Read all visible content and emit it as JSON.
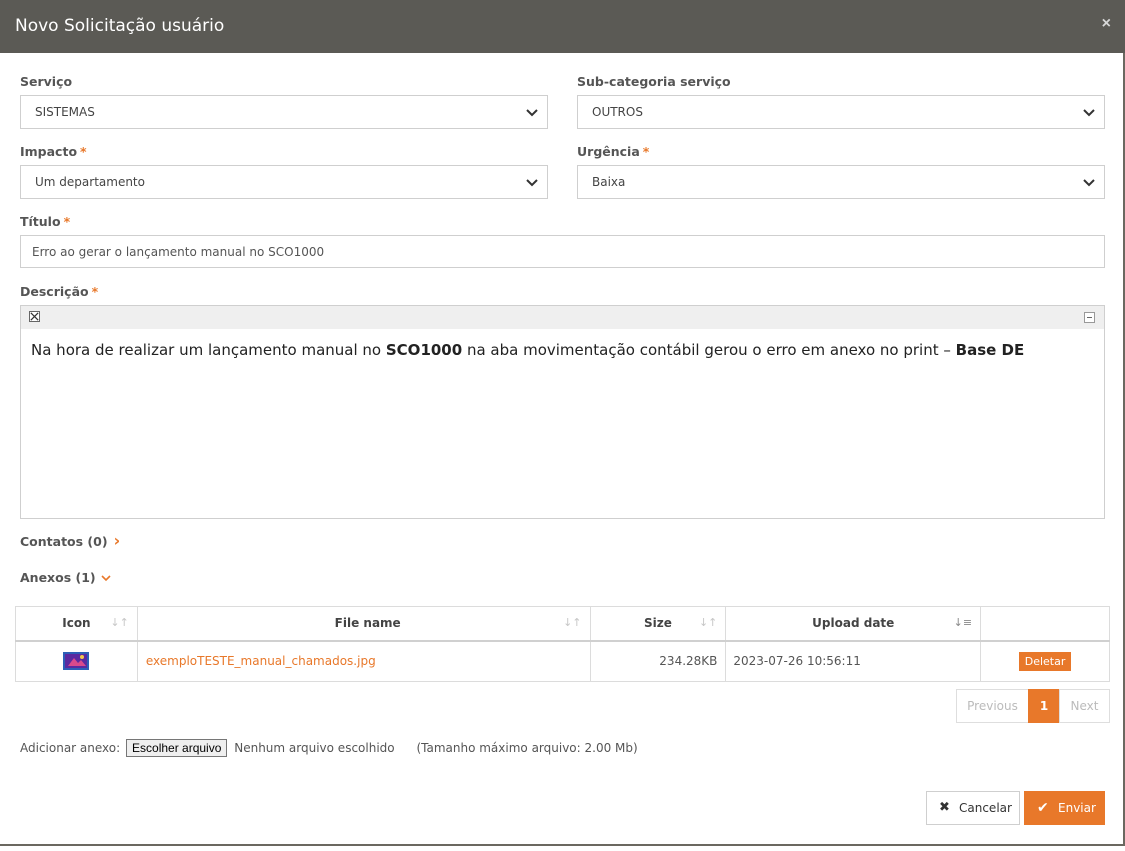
{
  "modal": {
    "title": "Novo Solicitação usuário",
    "close_glyph": "×"
  },
  "form": {
    "servico": {
      "label": "Serviço",
      "value": "SISTEMAS"
    },
    "subcategoria": {
      "label": "Sub-categoria serviço",
      "value": "OUTROS"
    },
    "impacto": {
      "label": "Impacto",
      "required": "*",
      "value": "Um departamento"
    },
    "urgencia": {
      "label": "Urgência",
      "required": "*",
      "value": "Baixa"
    },
    "titulo": {
      "label": "Título",
      "required": "*",
      "value": "Erro ao gerar o lançamento manual no SCO1000"
    },
    "descricao": {
      "label": "Descrição",
      "required": "*",
      "text_1": "Na hora de realizar um lançamento manual no ",
      "bold_1": "SCO1000",
      "text_2": " na aba movimentação contábil gerou o erro em anexo no print – ",
      "bold_2": "Base DE"
    }
  },
  "sections": {
    "contatos": {
      "label": "Contatos (0)",
      "arrow": "›"
    },
    "anexos": {
      "label": "Anexos (1)",
      "arrow": "⌄"
    }
  },
  "attachments_table": {
    "headers": {
      "icon": "Icon",
      "file_name": "File name",
      "size": "Size",
      "upload_date": "Upload date"
    },
    "rows": [
      {
        "file_name": "exemploTESTE_manual_chamados.jpg",
        "size": "234.28KB",
        "upload_date": "2023-07-26 10:56:11",
        "action": "Deletar"
      }
    ]
  },
  "pagination": {
    "previous": "Previous",
    "current": "1",
    "next": "Next"
  },
  "upload": {
    "label": "Adicionar anexo:",
    "button": "Escolher arquivo",
    "status": "Nenhum arquivo escolhido",
    "max_size": "(Tamanho máximo arquivo: 2.00 Mb)"
  },
  "actions": {
    "cancel": "Cancelar",
    "send": "Enviar"
  },
  "colors": {
    "accent": "#e8782a",
    "header_bg": "#5b5a55"
  },
  "icons": {
    "close": "close-icon",
    "cancel": "x-icon",
    "send": "check-icon",
    "chevron": "chevron-down-icon",
    "file": "image-file-icon"
  }
}
